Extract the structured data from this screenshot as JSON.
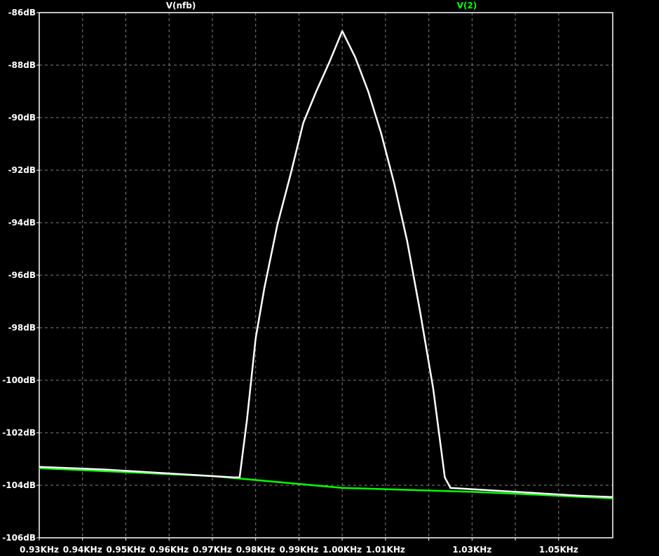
{
  "chart_data": {
    "type": "line",
    "x_unit": "KHz",
    "y_unit": "dB",
    "xlim": [
      0.93,
      1.0625
    ],
    "ylim": [
      -106,
      -86
    ],
    "grid": true,
    "background": "#000000",
    "axis_color": "#ffffff",
    "grid_color": "#7f7f7f",
    "x_ticks": [
      0.93,
      0.94,
      0.95,
      0.96,
      0.97,
      0.98,
      0.99,
      1.0,
      1.01,
      1.03,
      1.05
    ],
    "x_tick_labels": [
      "0.93KHz",
      "0.94KHz",
      "0.95KHz",
      "0.96KHz",
      "0.97KHz",
      "0.98KHz",
      "0.99KHz",
      "1.00KHz",
      "1.01KHz",
      "1.03KHz",
      "1.05KHz"
    ],
    "x_grid": [
      0.93,
      0.94,
      0.95,
      0.96,
      0.97,
      0.98,
      0.99,
      1.0,
      1.01,
      1.02,
      1.03,
      1.04,
      1.05
    ],
    "y_ticks": [
      -86,
      -88,
      -90,
      -92,
      -94,
      -96,
      -98,
      -100,
      -102,
      -104,
      -106
    ],
    "y_tick_labels": [
      "-86dB",
      "-88dB",
      "-90dB",
      "-92dB",
      "-94dB",
      "-96dB",
      "-98dB",
      "-100dB",
      "-102dB",
      "-104dB",
      "-106dB"
    ],
    "series": [
      {
        "name": "V(nfb)",
        "color": "#ffffff",
        "x": [
          0.93,
          0.945,
          0.96,
          0.975,
          0.9763,
          0.978,
          0.98,
          0.982,
          0.985,
          0.988,
          0.991,
          0.994,
          0.997,
          1.0,
          1.003,
          1.006,
          1.009,
          1.012,
          1.015,
          1.018,
          1.021,
          1.0237,
          1.025,
          1.035,
          1.045,
          1.055,
          1.0625
        ],
        "values": [
          -103.3,
          -103.4,
          -103.55,
          -103.7,
          -103.7,
          -101.5,
          -98.4,
          -96.5,
          -94.1,
          -92.2,
          -90.2,
          -89.0,
          -87.9,
          -86.7,
          -87.7,
          -89.0,
          -90.6,
          -92.5,
          -94.7,
          -97.4,
          -100.3,
          -103.7,
          -104.1,
          -104.2,
          -104.3,
          -104.4,
          -104.45
        ]
      },
      {
        "name": "V(2)",
        "color": "#00ff00",
        "x": [
          0.93,
          0.95,
          0.97,
          0.98,
          0.99,
          1.0,
          1.01,
          1.02,
          1.03,
          1.04,
          1.05,
          1.0625
        ],
        "values": [
          -103.35,
          -103.5,
          -103.65,
          -103.8,
          -103.95,
          -104.1,
          -104.15,
          -104.2,
          -104.25,
          -104.32,
          -104.4,
          -104.5
        ]
      }
    ]
  }
}
